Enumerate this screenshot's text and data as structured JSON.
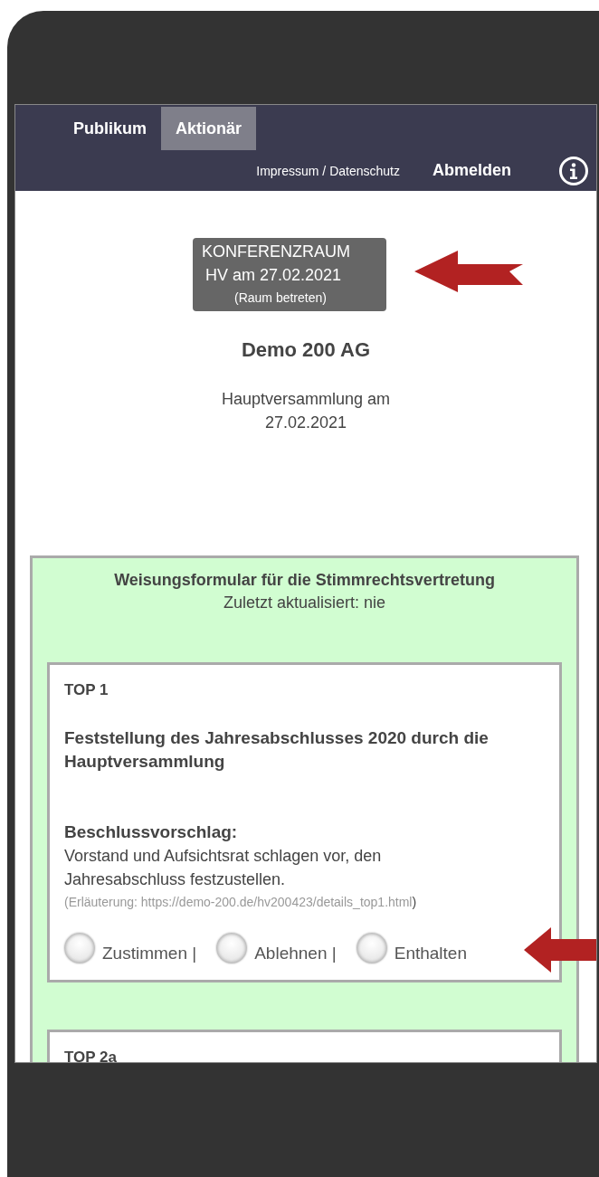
{
  "tabs": [
    {
      "label": "Publikum",
      "selected": false
    },
    {
      "label": "Aktionär",
      "selected": true
    }
  ],
  "header_links": {
    "imprint": "Impressum / Datenschutz",
    "logout": "Abmelden"
  },
  "room_button": {
    "line_1": "KONFERENZRAUM",
    "line_2": "HV am 27.02.2021",
    "line_3": "(Raum betreten)"
  },
  "company": "Demo 200 AG",
  "meeting": "Hauptversammlung am 27.02.2021",
  "form": {
    "title": "Weisungsformular für die Stimmrechtsvertretung",
    "updated": "Zuletzt aktualisiert: nie",
    "items": [
      {
        "label": "TOP 1",
        "heading": "Feststellung des Jahresabschlusses 2020 durch die Hauptversammlung",
        "proposal_label": "Beschlussvorschlag:",
        "proposal": "Vorstand und Aufsichtsrat schlagen vor, den Jahresabschluss festzustellen.",
        "note": "(Erläuterung: https://demo-200.de/hv200423/details_top1.html",
        "note_end": ")",
        "options": [
          {
            "label": "Zustimmen |",
            "selected": false
          },
          {
            "label": "Ablehnen |",
            "selected": false
          },
          {
            "label": "Enthalten",
            "selected": false
          }
        ]
      },
      {
        "label": "TOP 2a"
      }
    ]
  }
}
